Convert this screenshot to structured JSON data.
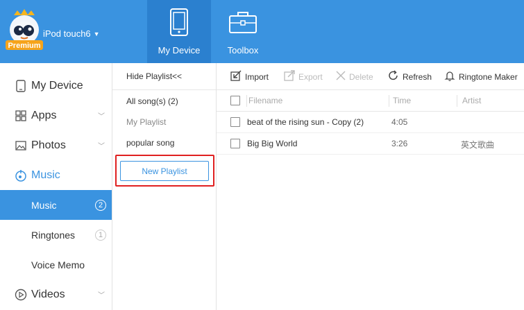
{
  "header": {
    "logo_text": "Premium",
    "device_name": "iPod touch6",
    "tabs": [
      {
        "label": "My Device",
        "icon": "tablet-icon",
        "active": true
      },
      {
        "label": "Toolbox",
        "icon": "toolbox-icon",
        "active": false
      }
    ]
  },
  "sidebar": {
    "items": [
      {
        "label": "My Device",
        "icon": "device-icon"
      },
      {
        "label": "Apps",
        "icon": "apps-grid-icon"
      },
      {
        "label": "Photos",
        "icon": "photo-icon"
      },
      {
        "label": "Music",
        "icon": "music-icon"
      },
      {
        "label": "Music",
        "badge": "2",
        "active": true
      },
      {
        "label": "Ringtones",
        "badge": "1"
      },
      {
        "label": "Voice Memo"
      },
      {
        "label": "Videos",
        "icon": "video-play-icon"
      }
    ]
  },
  "playlists": {
    "hide_label": "Hide Playlist<<",
    "items": [
      "All song(s)  (2)",
      "My Playlist",
      "popular song"
    ],
    "new_button": "New Playlist"
  },
  "toolbar": {
    "import": "Import",
    "export": "Export",
    "delete": "Delete",
    "refresh": "Refresh",
    "ringtone": "Ringtone Maker"
  },
  "table": {
    "columns": [
      "Filename",
      "Time",
      "Artist"
    ],
    "rows": [
      {
        "filename": "beat of the rising sun - Copy (2)",
        "time": "4:05",
        "artist": ""
      },
      {
        "filename": "Big Big World",
        "time": "3:26",
        "artist": "英文歌曲"
      }
    ]
  },
  "colors": {
    "accent": "#3a93e0",
    "active_tab": "#2b80cf",
    "highlight": "#e02020"
  }
}
